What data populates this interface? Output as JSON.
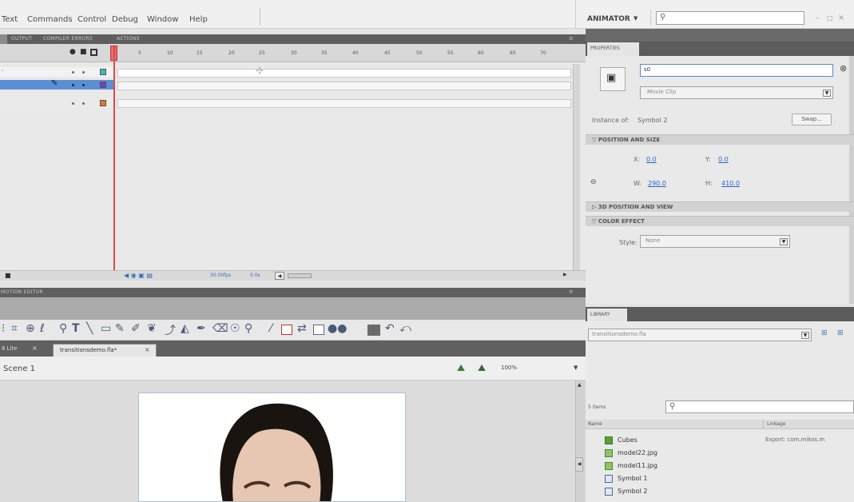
{
  "menu": {
    "items": [
      "Text",
      "Commands",
      "Control",
      "Debug",
      "Window",
      "Help"
    ]
  },
  "workspace": {
    "name": "ANIMATOR",
    "search_value": "",
    "window_controls": [
      "–",
      "□",
      "×"
    ]
  },
  "timeline": {
    "tabs": [
      "OUTPUT",
      "COMPILER ERRORS",
      "ACTIONS"
    ],
    "frame_numbers": [
      "5",
      "10",
      "15",
      "20",
      "25",
      "30",
      "35",
      "40",
      "45",
      "50",
      "55",
      "60",
      "65",
      "70"
    ],
    "layer_colors": [
      "#3dbcc0",
      "#7a3fc0",
      "#e07a2a"
    ],
    "footer_fps": "30.00fps",
    "footer_time": "0.0s"
  },
  "motion_editor": {
    "tab": "MOTION EDITOR"
  },
  "documents": {
    "tabs": [
      "6 Lite",
      "transitionsdemo.fla*"
    ],
    "active_tab": "transitionsdemo.fla*",
    "close_glyph": "×"
  },
  "scene": {
    "name": "Scene 1",
    "zoom": "100%"
  },
  "properties": {
    "tab": "PROPERTIES",
    "instance_name": "s0",
    "symbol_type": "Movie Clip",
    "instance_of_label": "Instance of:",
    "instance_of_value": "Symbol 2",
    "swap_button": "Swap...",
    "section_position": "POSITION AND SIZE",
    "x_label": "X:",
    "x_value": "0.0",
    "y_label": "Y:",
    "y_value": "0.0",
    "w_label": "W:",
    "w_value": "290.0",
    "h_label": "H:",
    "h_value": "410.0",
    "section_3d": "3D POSITION AND VIEW",
    "section_color": "COLOR EFFECT",
    "style_label": "Style:",
    "style_value": "None"
  },
  "library": {
    "tab": "LIBRARY",
    "document": "transitionsdemo.fla",
    "item_count": "5 items",
    "col_name": "Name",
    "col_linkage": "Linkage",
    "items": [
      {
        "name": "Cubes",
        "linkage": "Export: com.mikos.m"
      },
      {
        "name": "model22.jpg",
        "linkage": ""
      },
      {
        "name": "model11.jpg",
        "linkage": ""
      },
      {
        "name": "Symbol 1",
        "linkage": ""
      },
      {
        "name": "Symbol 2",
        "linkage": ""
      }
    ]
  },
  "colors": {
    "accent_red": "#e04848",
    "link_blue": "#2a66c8"
  }
}
